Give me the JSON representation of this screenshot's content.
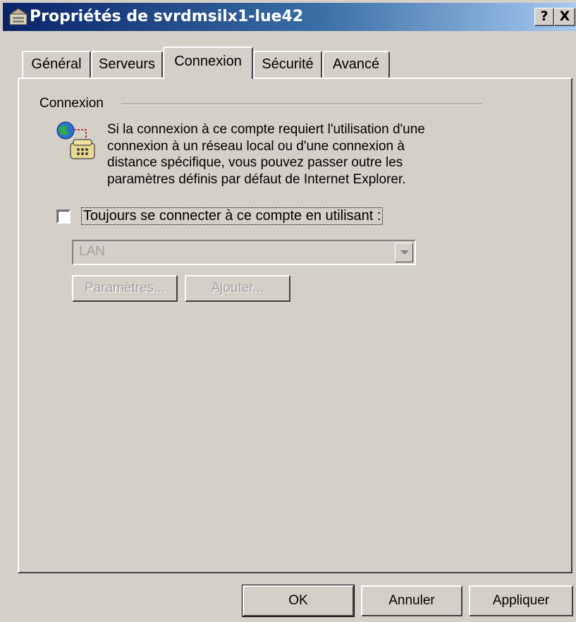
{
  "window": {
    "title": "Propriétés de svrdmsilx1-lue42",
    "help_button": "?",
    "close_button": "X"
  },
  "tabs": [
    {
      "label": "Général"
    },
    {
      "label": "Serveurs"
    },
    {
      "label": "Connexion"
    },
    {
      "label": "Sécurité"
    },
    {
      "label": "Avancé"
    }
  ],
  "active_tab": "Connexion",
  "connection_group": {
    "label": "Connexion",
    "description_lines": [
      "Si la connexion à ce compte requiert l'utilisation d'une",
      "connexion à un réseau local ou d'une connexion à",
      "distance spécifique, vous pouvez passer outre les",
      "paramètres définis par défaut de Internet Explorer."
    ],
    "checkbox_label": "Toujours se connecter à ce compte en utilisant :",
    "checkbox_checked": false,
    "connection_select": {
      "value": "LAN"
    },
    "settings_button": "Paramètres...",
    "add_button": "Ajouter..."
  },
  "footer": {
    "ok": "OK",
    "cancel": "Annuler",
    "apply": "Appliquer"
  },
  "colors": {
    "face": "#d4d0c8",
    "title_start": "#0a246a",
    "title_end": "#a6caf0",
    "disabled_text": "#a0a0a0"
  }
}
